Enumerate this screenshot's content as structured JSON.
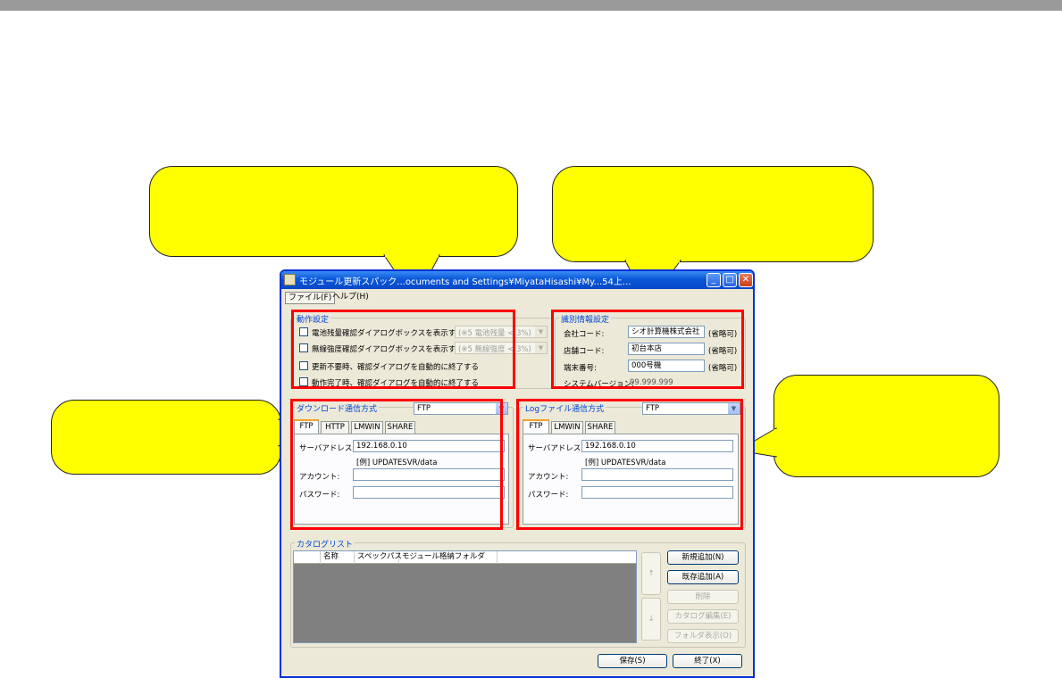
{
  "window": {
    "title": "モジュール更新スパック...ocuments and Settings¥MiyataHisashi¥My...54上...",
    "minimize": "_",
    "maximize": "□",
    "close": "✕"
  },
  "menu": {
    "file": "ファイル(F)",
    "help": "ヘルプ(H)"
  },
  "operation_settings": {
    "legend": "動作設定",
    "items": [
      {
        "label": "電池残量確認ダイアログボックスを表示する",
        "combo": "(※5 電池残量 < 3%)"
      },
      {
        "label": "無線強度確認ダイアログボックスを表示する",
        "combo": "(※5 無線強度 < 3%)"
      },
      {
        "label": "更新不要時、確認ダイアログを自動的に終了する"
      },
      {
        "label": "動作完了時、確認ダイアログを自動的に終了する"
      }
    ]
  },
  "identification": {
    "legend": "識別情報設定",
    "company_label": "会社コード:",
    "company_value": "シオ計算機株式会社",
    "store_label": "店舗コード:",
    "store_value": "初台本店",
    "terminal_label": "端末番号:",
    "terminal_value": "000号機",
    "optional": "(省略可)",
    "version_label": "システムバージョン:",
    "version_value": "99.999.999"
  },
  "download": {
    "legend": "ダウンロード通信方式",
    "method": "FTP",
    "tabs": [
      "FTP",
      "HTTP",
      "LMWIN",
      "SHARE"
    ],
    "server_label": "サーバアドレス:",
    "server_value": "192.168.0.10",
    "example": "[例] UPDATESVR/data",
    "account_label": "アカウント:",
    "account_value": "",
    "password_label": "パスワード:",
    "password_value": ""
  },
  "log": {
    "legend": "Logファイル通信方式",
    "method": "FTP",
    "tabs": [
      "FTP",
      "LMWIN",
      "SHARE"
    ],
    "server_label": "サーバアドレス:",
    "server_value": "192.168.0.10",
    "example": "[例] UPDATESVR/data",
    "account_label": "アカウント:",
    "account_value": "",
    "password_label": "パスワード:",
    "password_value": ""
  },
  "catalog": {
    "legend": "カタログリスト",
    "columns": [
      "",
      "名称",
      "スペックパス",
      "モジュール格納フォルダ"
    ],
    "up": "↑",
    "down": "↓",
    "buttons": {
      "new": "新規追加(N)",
      "existing": "既存追加(A)",
      "delete": "削除",
      "edit": "カタログ編集(E)",
      "folder": "フォルダ表示(O)"
    }
  },
  "footer": {
    "save": "保存(S)",
    "exit": "終了(X)"
  }
}
